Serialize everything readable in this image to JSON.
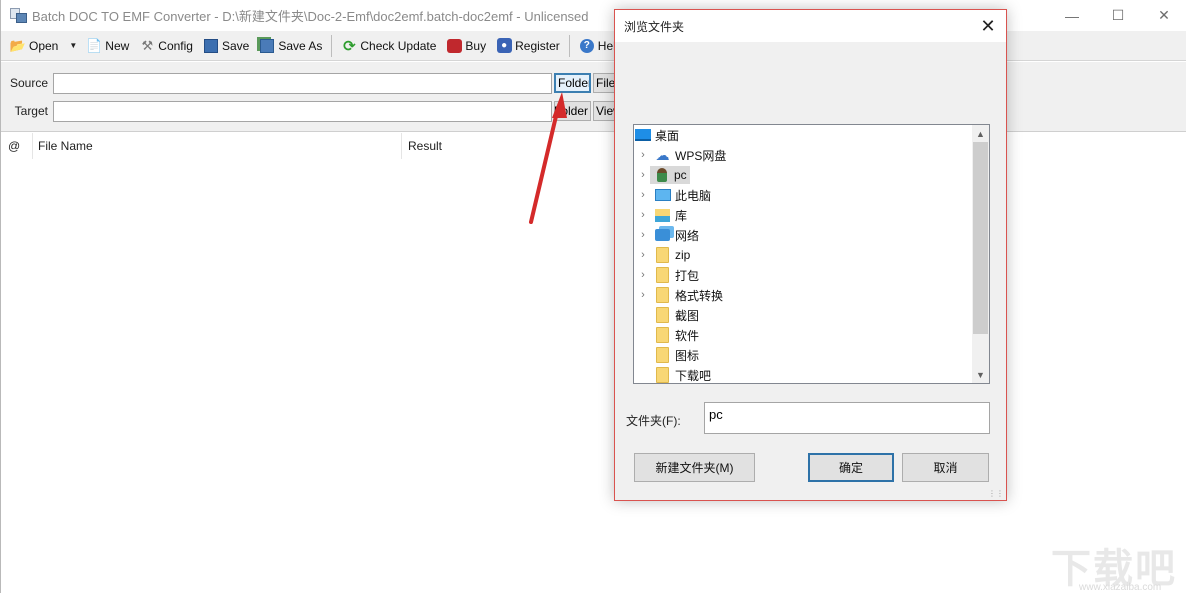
{
  "window": {
    "title": "Batch DOC TO EMF Converter - D:\\新建文件夹\\Doc-2-Emf\\doc2emf.batch-doc2emf - Unlicensed",
    "controls": {
      "minimize": "—",
      "maximize": "☐",
      "close": "✕"
    }
  },
  "toolbar": {
    "items": [
      {
        "label": "Open",
        "icon": "open-folder-icon",
        "glyph": "📂"
      },
      {
        "label": "New",
        "icon": "new-document-icon",
        "glyph": "📄"
      },
      {
        "label": "Config",
        "icon": "tools-icon",
        "glyph": "⚒"
      },
      {
        "label": "Save",
        "icon": "floppy-save-icon",
        "glyph": "💾"
      },
      {
        "label": "Save As",
        "icon": "save-as-icon",
        "glyph": "💾"
      },
      {
        "label": "Check Update",
        "icon": "refresh-icon",
        "glyph": "⟳"
      },
      {
        "label": "Buy",
        "icon": "cart-icon",
        "glyph": "🛒"
      },
      {
        "label": "Register",
        "icon": "user-icon",
        "glyph": "👤"
      },
      {
        "label": "Help",
        "icon": "help-icon",
        "glyph": "?"
      }
    ],
    "dropdown_caret": "▼"
  },
  "paths": {
    "source_label": "Source",
    "source_value": "",
    "source_folder_btn": "Folder",
    "source_file_btn": "File",
    "target_label": "Target",
    "target_value": "",
    "target_folder_btn": "Folder",
    "target_view_btn": "View"
  },
  "list": {
    "columns": [
      "@",
      "File Name",
      "Result"
    ]
  },
  "dialog": {
    "title": "浏览文件夹",
    "close": "✕",
    "tree": [
      {
        "label": "桌面",
        "icon": "desktop-icon",
        "expandable": false,
        "indent": 0
      },
      {
        "label": "WPS网盘",
        "icon": "cloud-icon",
        "expandable": true,
        "indent": 1
      },
      {
        "label": "pc",
        "icon": "user-folder-icon",
        "expandable": true,
        "indent": 1,
        "selected": true
      },
      {
        "label": "此电脑",
        "icon": "computer-icon",
        "expandable": true,
        "indent": 1
      },
      {
        "label": "库",
        "icon": "library-icon",
        "expandable": true,
        "indent": 1
      },
      {
        "label": "网络",
        "icon": "network-icon",
        "expandable": true,
        "indent": 1
      },
      {
        "label": "zip",
        "icon": "folder-icon",
        "expandable": true,
        "indent": 1
      },
      {
        "label": "打包",
        "icon": "folder-icon",
        "expandable": true,
        "indent": 1
      },
      {
        "label": "格式转换",
        "icon": "folder-icon",
        "expandable": true,
        "indent": 1
      },
      {
        "label": "截图",
        "icon": "folder-icon",
        "expandable": false,
        "indent": 1
      },
      {
        "label": "软件",
        "icon": "folder-icon",
        "expandable": false,
        "indent": 1
      },
      {
        "label": "图标",
        "icon": "folder-icon",
        "expandable": false,
        "indent": 1
      },
      {
        "label": "下载吧",
        "icon": "folder-icon",
        "expandable": false,
        "indent": 1
      }
    ],
    "folder_label": "文件夹(F):",
    "folder_value": "pc",
    "new_folder_btn": "新建文件夹(M)",
    "ok_btn": "确定",
    "cancel_btn": "取消"
  },
  "watermark": {
    "text": "下载吧",
    "url_text": "www.xiazaiba.com"
  },
  "colors": {
    "dialog_border": "#d9534f",
    "arrow": "#d42a2a",
    "focus_border": "#3c7fb1"
  }
}
